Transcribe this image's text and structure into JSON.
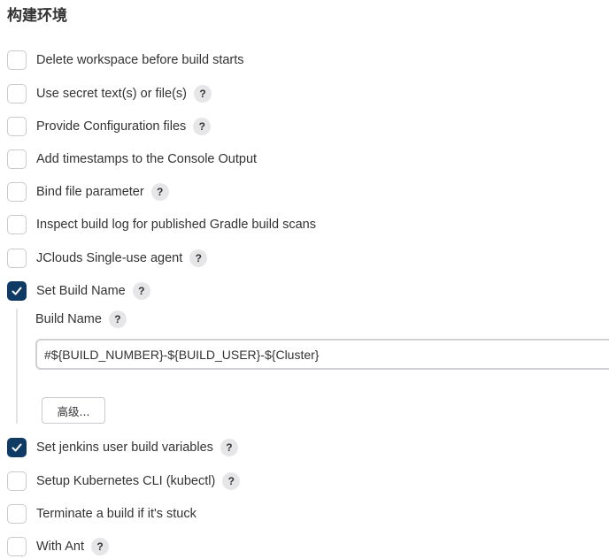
{
  "section": {
    "title": "构建环境"
  },
  "options": [
    {
      "label": "Delete workspace before build starts",
      "checked": false,
      "help": ""
    },
    {
      "label": "Use secret text(s) or file(s)",
      "checked": false,
      "help": "?"
    },
    {
      "label": "Provide Configuration files",
      "checked": false,
      "help": "?"
    },
    {
      "label": "Add timestamps to the Console Output",
      "checked": false,
      "help": ""
    },
    {
      "label": "Bind file parameter",
      "checked": false,
      "help": "?"
    },
    {
      "label": "Inspect build log for published Gradle build scans",
      "checked": false,
      "help": ""
    },
    {
      "label": "JClouds Single-use agent",
      "checked": false,
      "help": "?"
    },
    {
      "label": "Set Build Name",
      "checked": true,
      "help": "?"
    },
    {
      "label": "Set jenkins user build variables",
      "checked": true,
      "help": "?"
    },
    {
      "label": "Setup Kubernetes CLI (kubectl)",
      "checked": false,
      "help": "?"
    },
    {
      "label": "Terminate a build if it's stuck",
      "checked": false,
      "help": ""
    },
    {
      "label": "With Ant",
      "checked": false,
      "help": "?"
    }
  ],
  "build_name": {
    "label": "Build Name",
    "help": "?",
    "value": "#${BUILD_NUMBER}-${BUILD_USER}-${Cluster}",
    "advanced_label": "高级..."
  },
  "colors": {
    "checked": "#0f3a63",
    "border": "#c9c9cf",
    "help_bg": "#e6e6e9"
  }
}
